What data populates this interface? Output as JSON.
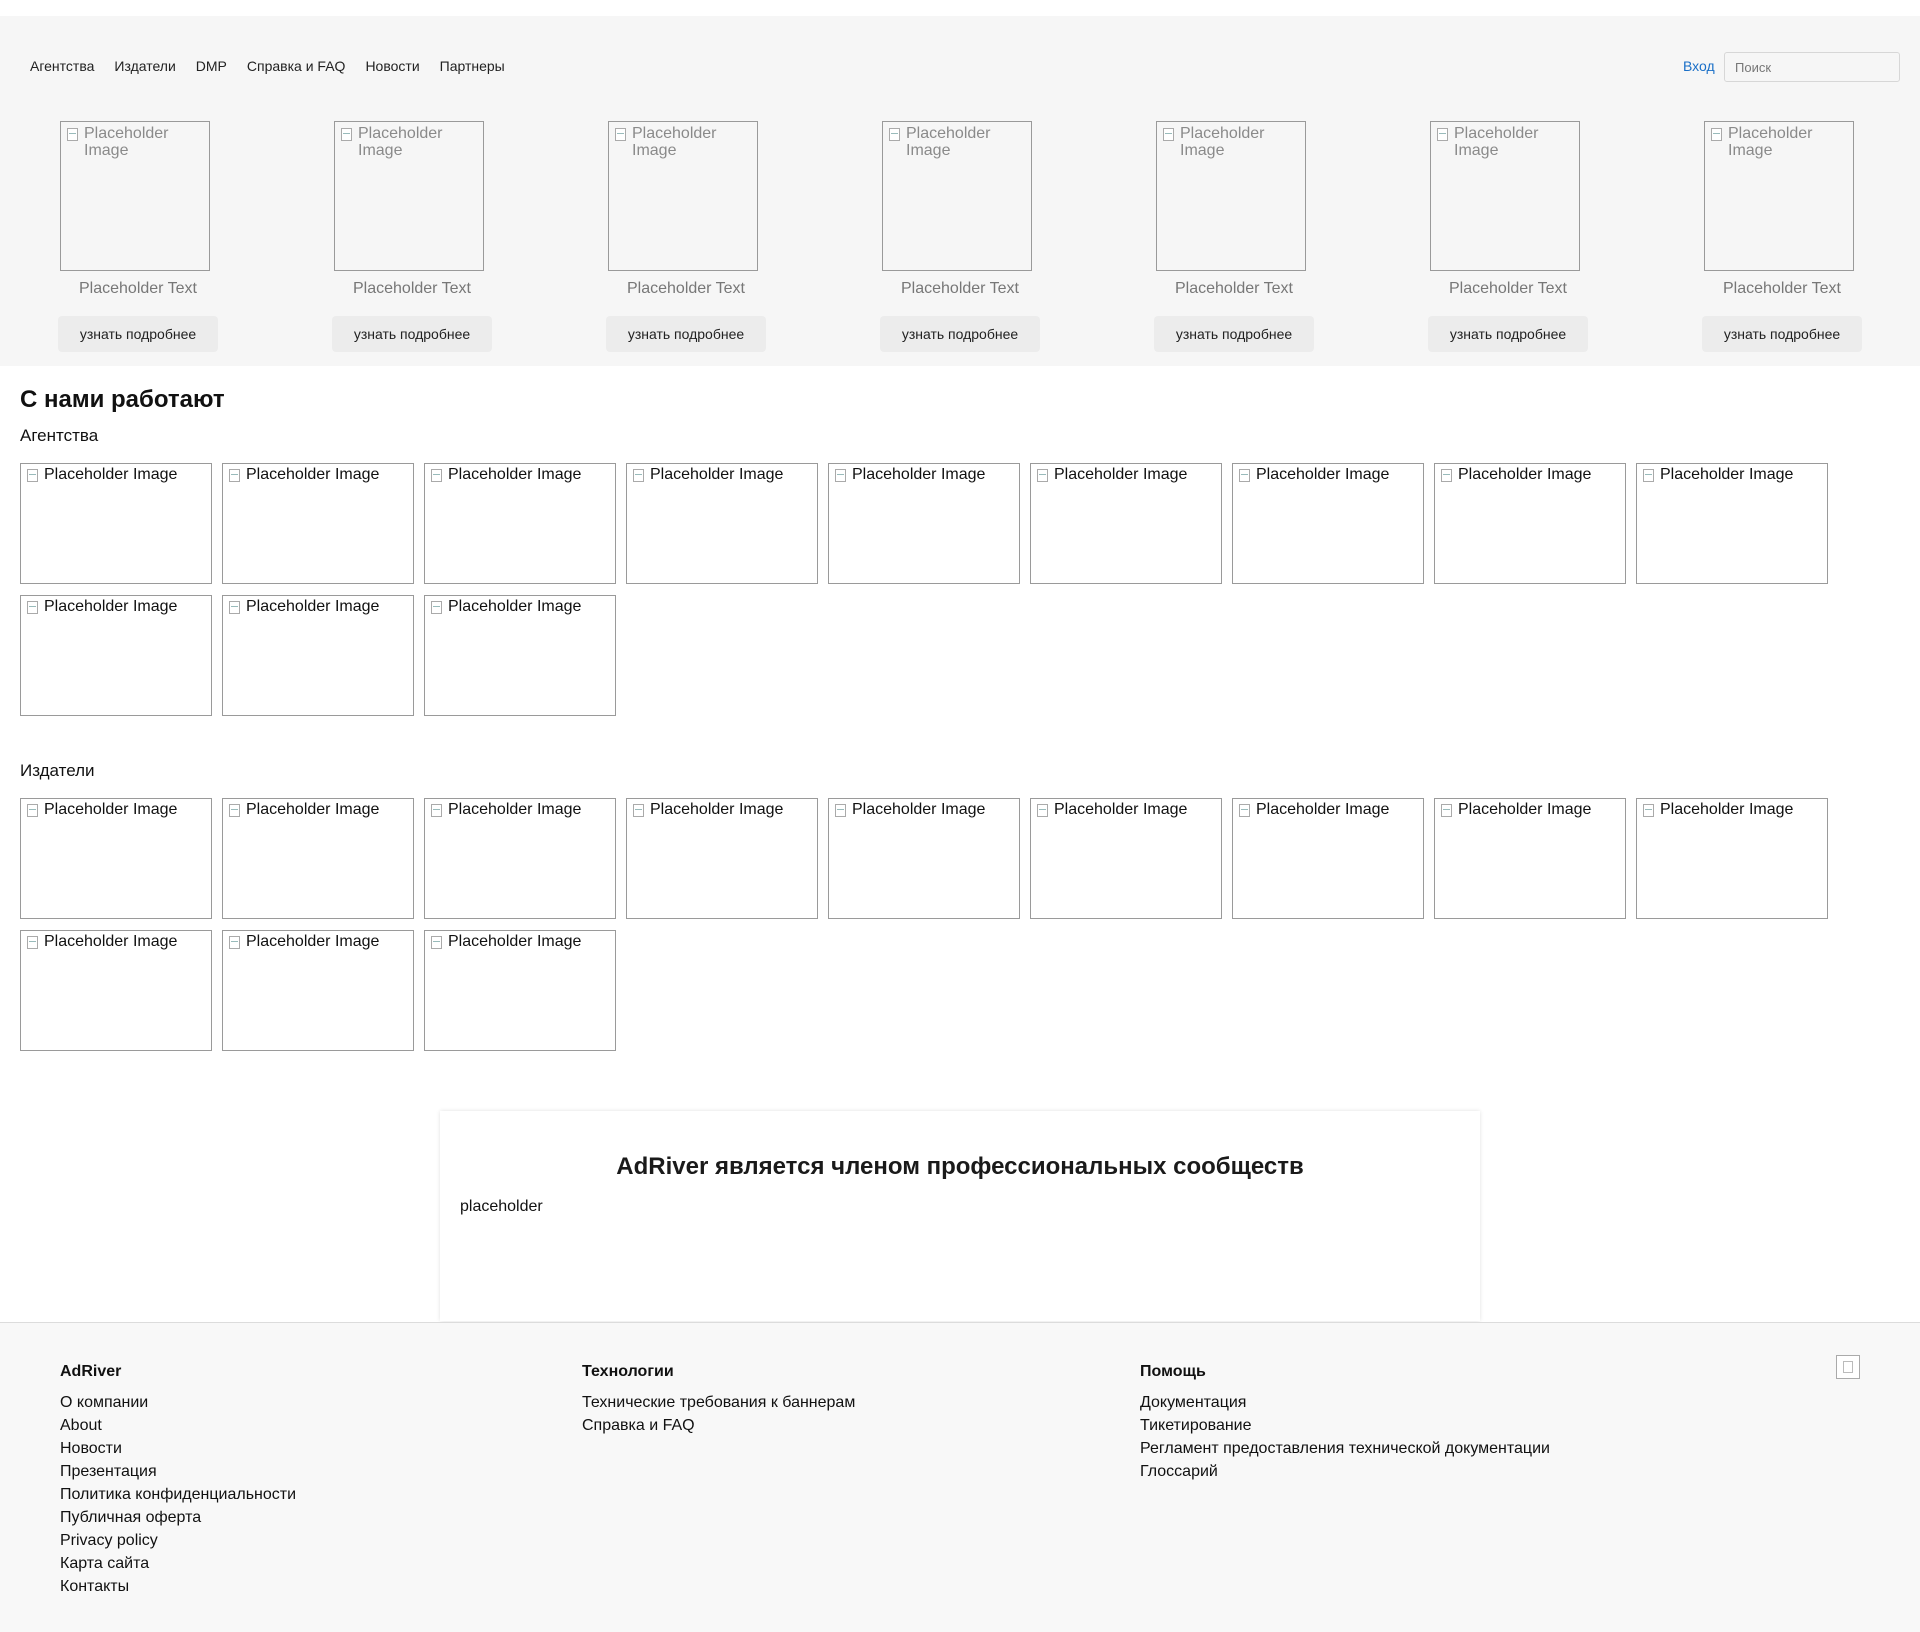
{
  "nav": {
    "items": [
      "Агентства",
      "Издатели",
      "DMP",
      "Справка и FAQ",
      "Новости",
      "Партнеры"
    ],
    "login": "Вход",
    "search_placeholder": "Поиск"
  },
  "hero": {
    "cards": [
      {
        "image_alt": "Placeholder Image",
        "caption": "Placeholder Text",
        "button": "узнать подробнее"
      },
      {
        "image_alt": "Placeholder Image",
        "caption": "Placeholder Text",
        "button": "узнать подробнее"
      },
      {
        "image_alt": "Placeholder Image",
        "caption": "Placeholder Text",
        "button": "узнать подробнее"
      },
      {
        "image_alt": "Placeholder Image",
        "caption": "Placeholder Text",
        "button": "узнать подробнее"
      },
      {
        "image_alt": "Placeholder Image",
        "caption": "Placeholder Text",
        "button": "узнать подробнее"
      },
      {
        "image_alt": "Placeholder Image",
        "caption": "Placeholder Text",
        "button": "узнать подробнее"
      },
      {
        "image_alt": "Placeholder Image",
        "caption": "Placeholder Text",
        "button": "узнать подробнее"
      }
    ]
  },
  "partners": {
    "title": "С нами работают",
    "agencies": {
      "label": "Агентства",
      "logos": [
        "Placeholder Image",
        "Placeholder Image",
        "Placeholder Image",
        "Placeholder Image",
        "Placeholder Image",
        "Placeholder Image",
        "Placeholder Image",
        "Placeholder Image",
        "Placeholder Image",
        "Placeholder Image",
        "Placeholder Image",
        "Placeholder Image"
      ]
    },
    "publishers": {
      "label": "Издатели",
      "logos": [
        "Placeholder Image",
        "Placeholder Image",
        "Placeholder Image",
        "Placeholder Image",
        "Placeholder Image",
        "Placeholder Image",
        "Placeholder Image",
        "Placeholder Image",
        "Placeholder Image",
        "Placeholder Image",
        "Placeholder Image",
        "Placeholder Image"
      ]
    }
  },
  "members": {
    "title": "AdRiver является членом профессиональных сообществ",
    "placeholder": "placeholder"
  },
  "footer": {
    "columns": [
      {
        "title": "AdRiver",
        "links": [
          "О компании",
          "About",
          "Новости",
          "Презентация",
          "Политика конфиденциальности",
          "Публичная оферта",
          "Privacy policy",
          "Карта сайта",
          "Контакты"
        ]
      },
      {
        "title": "Технологии",
        "links": [
          "Технические требования к баннерам",
          "Справка и FAQ"
        ]
      },
      {
        "title": "Помощь",
        "links": [
          "Документация",
          "Тикетирование",
          "Регламент предоставления технической документации",
          "Глоссарий"
        ]
      }
    ]
  },
  "colors": {
    "accent_link": "#1a6fc7",
    "hero_bg": "#f6f6f6",
    "footer_bg": "#f8f8f8",
    "button_bg": "#ececec"
  }
}
